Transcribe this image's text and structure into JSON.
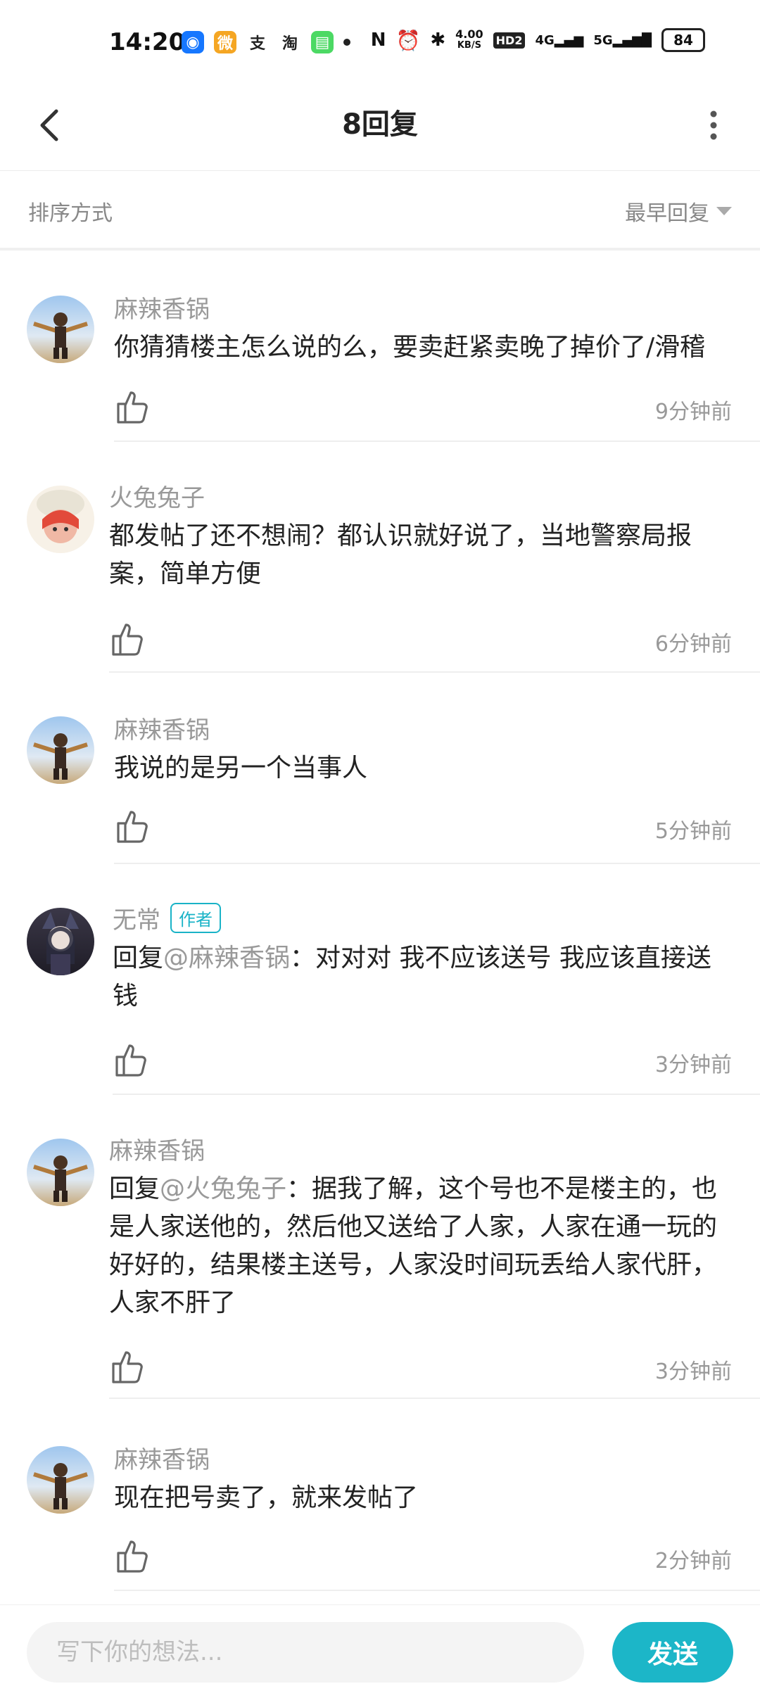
{
  "status_bar": {
    "time": "14:20",
    "apps": [
      {
        "icon": "qq-browser-icon",
        "color": "#1677ff",
        "glyph": "◉"
      },
      {
        "icon": "weibo-icon",
        "color": "#f5a623",
        "glyph": "微"
      },
      {
        "icon": "alipay-icon",
        "color": "#ffffff",
        "glyph": "支"
      },
      {
        "icon": "taobao-icon",
        "color": "#ffffff",
        "glyph": "淘"
      },
      {
        "icon": "message-icon",
        "color": "#4cd964",
        "glyph": "▤"
      }
    ],
    "speed_value": "4.00",
    "speed_unit": "KB/S",
    "hd_label": "HD2",
    "net_4g": "4G",
    "net_5g": "5G",
    "battery": "84"
  },
  "nav": {
    "title": "8回复"
  },
  "sort": {
    "label": "排序方式",
    "value": "最早回复"
  },
  "comments": [
    {
      "name": "麻辣香锅",
      "text": "你猜猜楼主怎么说的么，要卖赶紧卖晚了掉价了/滑稽",
      "time": "9分钟前"
    },
    {
      "name": "火兔兔子",
      "text": "都发帖了还不想闹？都认识就好说了，当地警察局报案，简单方便",
      "time": "6分钟前"
    },
    {
      "name": "麻辣香锅",
      "text": "我说的是另一个当事人",
      "time": "5分钟前"
    },
    {
      "name": "无常",
      "author_tag": "作者",
      "reply_prefix": "回复",
      "mention": "@麻辣香锅",
      "text": "：对对对 我不应该送号 我应该直接送钱",
      "time": "3分钟前"
    },
    {
      "name": "麻辣香锅",
      "reply_prefix": "回复",
      "mention": "@火兔兔子",
      "text": "：据我了解，这个号也不是楼主的，也是人家送他的，然后他又送给了人家，人家在通一玩的好好的，结果楼主送号，人家没时间玩丢给人家代肝，人家不肝了",
      "time": "3分钟前"
    },
    {
      "name": "麻辣香锅",
      "text": "现在把号卖了，就来发帖了",
      "time": "2分钟前"
    }
  ],
  "input": {
    "placeholder": "写下你的想法...",
    "send_label": "发送"
  },
  "colors": {
    "accent": "#1cb6c8",
    "muted_text": "#999999"
  }
}
